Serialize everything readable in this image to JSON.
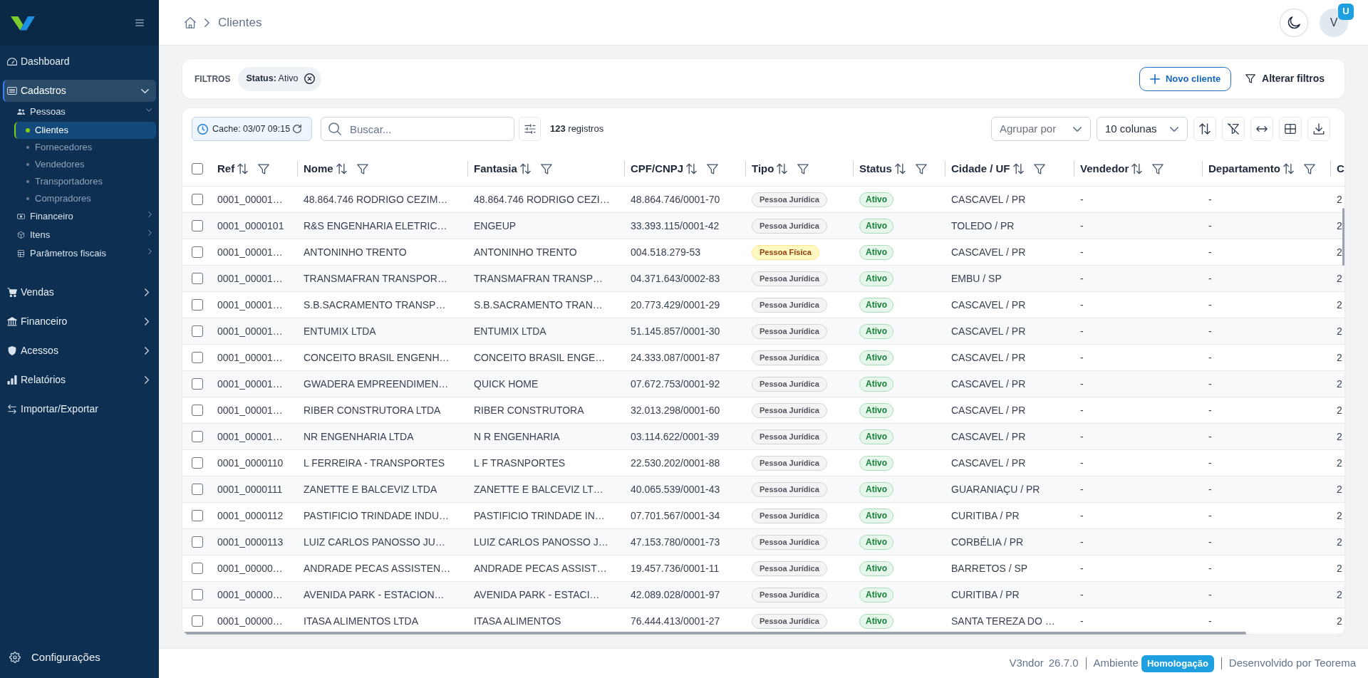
{
  "sidebar": {
    "items": [
      {
        "label": "Dashboard",
        "kind": "link",
        "selected": false
      },
      {
        "label": "Cadastros",
        "kind": "group",
        "selected": true,
        "expanded": true,
        "children": [
          {
            "label": "Pessoas",
            "selected": false,
            "expanded": true,
            "children": [
              {
                "label": "Clientes",
                "selected": true
              },
              {
                "label": "Fornecedores",
                "selected": false
              },
              {
                "label": "Vendedores",
                "selected": false
              },
              {
                "label": "Transportadores",
                "selected": false
              },
              {
                "label": "Compradores",
                "selected": false
              }
            ]
          },
          {
            "label": "Financeiro",
            "selected": false,
            "expanded": false
          },
          {
            "label": "Itens",
            "selected": false,
            "expanded": false
          },
          {
            "label": "Parâmetros fiscais",
            "selected": false,
            "expanded": false
          }
        ]
      },
      {
        "label": "Vendas",
        "kind": "group",
        "selected": false,
        "expanded": false
      },
      {
        "label": "Financeiro",
        "kind": "group",
        "selected": false,
        "expanded": false
      },
      {
        "label": "Acessos",
        "kind": "group",
        "selected": false,
        "expanded": false
      },
      {
        "label": "Relatórios",
        "kind": "group",
        "selected": false,
        "expanded": false
      },
      {
        "label": "Importar/Exportar",
        "kind": "link",
        "selected": false
      }
    ],
    "footer_item": {
      "label": "Configurações"
    }
  },
  "breadcrumb": {
    "items": [
      {
        "label": "Clientes"
      }
    ]
  },
  "user": {
    "initial": "V",
    "badge": "U"
  },
  "filters": {
    "title": "FILTROS",
    "chips": [
      {
        "text": "**Status:** Ativo"
      }
    ],
    "new_button": "Novo cliente",
    "edit_button": "Alterar filtros"
  },
  "toolbar": {
    "cache_button": "Cache: 03/07 09:15",
    "search": {
      "placeholder": "Buscar..."
    },
    "record_count": "**123** registros",
    "group_by": {
      "placeholder": "Agrupar por"
    },
    "columns_select": {
      "value": "10 colunas"
    }
  },
  "table": {
    "select_all_checked": false,
    "columns": [
      {
        "label": "Ref",
        "sortable": true,
        "filterable": true
      },
      {
        "label": "Nome",
        "sortable": true,
        "filterable": true
      },
      {
        "label": "Fantasia",
        "sortable": true,
        "filterable": true
      },
      {
        "label": "CPF/CNPJ",
        "sortable": true,
        "filterable": true
      },
      {
        "label": "Tipo",
        "sortable": true,
        "filterable": true
      },
      {
        "label": "Status",
        "sortable": true,
        "filterable": true
      },
      {
        "label": "Cidade / UF",
        "sortable": true,
        "filterable": true
      },
      {
        "label": "Vendedor",
        "sortable": true,
        "filterable": true
      },
      {
        "label": "Departamento",
        "sortable": true,
        "filterable": true
      },
      {
        "label": "C",
        "sortable": false,
        "filterable": false
      }
    ],
    "rows": [
      {
        "checked": false,
        "ref": "0001_00001…",
        "nome": "48.864.746 RODRIGO CEZIM…",
        "fantasia": "48.864.746 RODRIGO CEZI…",
        "cpf_cnpj": "48.864.746/0001-70",
        "tipo": {
          "text": "Pessoa Jurídica",
          "kind": "juridica"
        },
        "status": {
          "text": "Ativo",
          "kind": "ativo"
        },
        "cidade_uf": "CASCAVEL / PR",
        "vendedor": "-",
        "departamento": "-",
        "column_11": "2"
      },
      {
        "checked": false,
        "ref": "0001_0000101",
        "nome": "R&S ENGENHARIA ELETRIC…",
        "fantasia": "ENGEUP",
        "cpf_cnpj": "33.393.115/0001-42",
        "tipo": {
          "text": "Pessoa Jurídica",
          "kind": "juridica"
        },
        "status": {
          "text": "Ativo",
          "kind": "ativo"
        },
        "cidade_uf": "TOLEDO / PR",
        "vendedor": "-",
        "departamento": "-",
        "column_11": "2"
      },
      {
        "checked": false,
        "ref": "0001_00001…",
        "nome": "ANTONINHO TRENTO",
        "fantasia": "ANTONINHO TRENTO",
        "cpf_cnpj": "004.518.279-53",
        "tipo": {
          "text": "Pessoa Física",
          "kind": "fisica"
        },
        "status": {
          "text": "Ativo",
          "kind": "ativo"
        },
        "cidade_uf": "CASCAVEL / PR",
        "vendedor": "-",
        "departamento": "-",
        "column_11": "2"
      },
      {
        "checked": false,
        "ref": "0001_00001…",
        "nome": "TRANSMAFRAN TRANSPOR…",
        "fantasia": "TRANSMAFRAN TRANSP…",
        "cpf_cnpj": "04.371.643/0002-83",
        "tipo": {
          "text": "Pessoa Jurídica",
          "kind": "juridica"
        },
        "status": {
          "text": "Ativo",
          "kind": "ativo"
        },
        "cidade_uf": "EMBU / SP",
        "vendedor": "-",
        "departamento": "-",
        "column_11": "2"
      },
      {
        "checked": false,
        "ref": "0001_00001…",
        "nome": "S.B.SACRAMENTO TRANSP…",
        "fantasia": "S.B.SACRAMENTO TRAN…",
        "cpf_cnpj": "20.773.429/0001-29",
        "tipo": {
          "text": "Pessoa Jurídica",
          "kind": "juridica"
        },
        "status": {
          "text": "Ativo",
          "kind": "ativo"
        },
        "cidade_uf": "CASCAVEL / PR",
        "vendedor": "-",
        "departamento": "-",
        "column_11": "2"
      },
      {
        "checked": false,
        "ref": "0001_00001…",
        "nome": "ENTUMIX LTDA",
        "fantasia": "ENTUMIX LTDA",
        "cpf_cnpj": "51.145.857/0001-30",
        "tipo": {
          "text": "Pessoa Jurídica",
          "kind": "juridica"
        },
        "status": {
          "text": "Ativo",
          "kind": "ativo"
        },
        "cidade_uf": "CASCAVEL / PR",
        "vendedor": "-",
        "departamento": "-",
        "column_11": "2"
      },
      {
        "checked": false,
        "ref": "0001_00001…",
        "nome": "CONCEITO BRASIL ENGENH…",
        "fantasia": "CONCEITO BRASIL ENGE…",
        "cpf_cnpj": "24.333.087/0001-87",
        "tipo": {
          "text": "Pessoa Jurídica",
          "kind": "juridica"
        },
        "status": {
          "text": "Ativo",
          "kind": "ativo"
        },
        "cidade_uf": "CASCAVEL / PR",
        "vendedor": "-",
        "departamento": "-",
        "column_11": "2"
      },
      {
        "checked": false,
        "ref": "0001_00001…",
        "nome": "GWADERA EMPREENDIMEN…",
        "fantasia": "QUICK HOME",
        "cpf_cnpj": "07.672.753/0001-92",
        "tipo": {
          "text": "Pessoa Jurídica",
          "kind": "juridica"
        },
        "status": {
          "text": "Ativo",
          "kind": "ativo"
        },
        "cidade_uf": "CASCAVEL / PR",
        "vendedor": "-",
        "departamento": "-",
        "column_11": "2"
      },
      {
        "checked": false,
        "ref": "0001_00001…",
        "nome": "RIBER CONSTRUTORA LTDA",
        "fantasia": "RIBER CONSTRUTORA",
        "cpf_cnpj": "32.013.298/0001-60",
        "tipo": {
          "text": "Pessoa Jurídica",
          "kind": "juridica"
        },
        "status": {
          "text": "Ativo",
          "kind": "ativo"
        },
        "cidade_uf": "CASCAVEL / PR",
        "vendedor": "-",
        "departamento": "-",
        "column_11": "2"
      },
      {
        "checked": false,
        "ref": "0001_00001…",
        "nome": "NR ENGENHARIA LTDA",
        "fantasia": "N R ENGENHARIA",
        "cpf_cnpj": "03.114.622/0001-39",
        "tipo": {
          "text": "Pessoa Jurídica",
          "kind": "juridica"
        },
        "status": {
          "text": "Ativo",
          "kind": "ativo"
        },
        "cidade_uf": "CASCAVEL / PR",
        "vendedor": "-",
        "departamento": "-",
        "column_11": "2"
      },
      {
        "checked": false,
        "ref": "0001_0000110",
        "nome": "L FERREIRA - TRANSPORTES",
        "fantasia": "L F TRASNPORTES",
        "cpf_cnpj": "22.530.202/0001-88",
        "tipo": {
          "text": "Pessoa Jurídica",
          "kind": "juridica"
        },
        "status": {
          "text": "Ativo",
          "kind": "ativo"
        },
        "cidade_uf": "CASCAVEL / PR",
        "vendedor": "-",
        "departamento": "-",
        "column_11": "2"
      },
      {
        "checked": false,
        "ref": "0001_0000111",
        "nome": "ZANETTE E BALCEVIZ LTDA",
        "fantasia": "ZANETTE E BALCEVIZ LT…",
        "cpf_cnpj": "40.065.539/0001-43",
        "tipo": {
          "text": "Pessoa Jurídica",
          "kind": "juridica"
        },
        "status": {
          "text": "Ativo",
          "kind": "ativo"
        },
        "cidade_uf": "GUARANIAÇU / PR",
        "vendedor": "-",
        "departamento": "-",
        "column_11": "2"
      },
      {
        "checked": false,
        "ref": "0001_0000112",
        "nome": "PASTIFICIO TRINDADE INDU…",
        "fantasia": "PASTIFICIO TRINDADE IN…",
        "cpf_cnpj": "07.701.567/0001-34",
        "tipo": {
          "text": "Pessoa Jurídica",
          "kind": "juridica"
        },
        "status": {
          "text": "Ativo",
          "kind": "ativo"
        },
        "cidade_uf": "CURITIBA / PR",
        "vendedor": "-",
        "departamento": "-",
        "column_11": "2"
      },
      {
        "checked": false,
        "ref": "0001_0000113",
        "nome": "LUIZ CARLOS PANOSSO JU…",
        "fantasia": "LUIZ CARLOS PANOSSO J…",
        "cpf_cnpj": "47.153.780/0001-73",
        "tipo": {
          "text": "Pessoa Jurídica",
          "kind": "juridica"
        },
        "status": {
          "text": "Ativo",
          "kind": "ativo"
        },
        "cidade_uf": "CORBÉLIA / PR",
        "vendedor": "-",
        "departamento": "-",
        "column_11": "2"
      },
      {
        "checked": false,
        "ref": "0001_00000…",
        "nome": "ANDRADE PECAS ASSISTEN…",
        "fantasia": "ANDRADE PECAS ASSIST…",
        "cpf_cnpj": "19.457.736/0001-11",
        "tipo": {
          "text": "Pessoa Jurídica",
          "kind": "juridica"
        },
        "status": {
          "text": "Ativo",
          "kind": "ativo"
        },
        "cidade_uf": "BARRETOS / SP",
        "vendedor": "-",
        "departamento": "-",
        "column_11": "2"
      },
      {
        "checked": false,
        "ref": "0001_00000…",
        "nome": "AVENIDA PARK - ESTACION…",
        "fantasia": "AVENIDA PARK - ESTACI…",
        "cpf_cnpj": "42.089.028/0001-97",
        "tipo": {
          "text": "Pessoa Jurídica",
          "kind": "juridica"
        },
        "status": {
          "text": "Ativo",
          "kind": "ativo"
        },
        "cidade_uf": "CURITIBA / PR",
        "vendedor": "-",
        "departamento": "-",
        "column_11": "2"
      },
      {
        "checked": false,
        "ref": "0001_00000…",
        "nome": "ITASA ALIMENTOS LTDA",
        "fantasia": "ITASA ALIMENTOS",
        "cpf_cnpj": "76.444.413/0001-27",
        "tipo": {
          "text": "Pessoa Jurídica",
          "kind": "juridica"
        },
        "status": {
          "text": "Ativo",
          "kind": "ativo"
        },
        "cidade_uf": "SANTA TEREZA DO …",
        "vendedor": "-",
        "departamento": "-",
        "column_11": "2"
      }
    ]
  },
  "footer": {
    "app": "V3ndor",
    "version": "26.7.0",
    "environment_label": "Ambiente",
    "environment": "Homologação",
    "credit": "Desenvolvido por Teorema"
  }
}
